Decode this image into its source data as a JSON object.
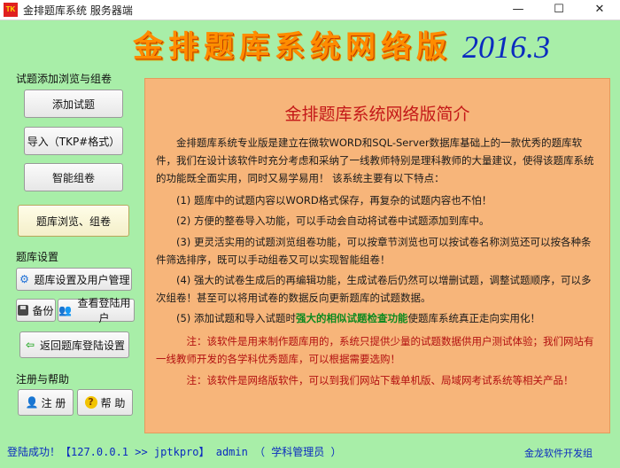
{
  "window": {
    "app_icon_text": "TK",
    "title": "金排题库系统 服务器端",
    "minimize": "—",
    "maximize": "☐",
    "close": "✕"
  },
  "banner": {
    "title": "金排题库系统网络版",
    "version": "2016.3"
  },
  "sidebar": {
    "section_browse": "试题添加浏览与组卷",
    "btn_add": "添加试题",
    "btn_import": "导入（TKP#格式）",
    "btn_smart": "智能组卷",
    "btn_browse": "题库浏览、组卷",
    "section_settings": "题库设置",
    "btn_settings": "题库设置及用户管理",
    "btn_backup": "备份",
    "btn_view_users": "查看登陆用户",
    "btn_return": "返回题库登陆设置",
    "section_register": "注册与帮助",
    "btn_register": "注 册",
    "btn_help": "帮 助"
  },
  "intro": {
    "title": "金排题库系统网络版简介",
    "p0": "金排题库系统专业版是建立在微软WORD和SQL-Server数据库基础上的一款优秀的题库软件，我们在设计该软件时充分考虑和采纳了一线教师特别是理科教师的大量建议，使得该题库系统的功能既全面实用，同时又易学易用！ 该系统主要有以下特点：",
    "p1": "(1) 题库中的试题内容以WORD格式保存，再复杂的试题内容也不怕！",
    "p2": "(2) 方便的整卷导入功能，可以手动会自动将试卷中试题添加到库中。",
    "p3": "(3) 更灵活实用的试题浏览组卷功能，可以按章节浏览也可以按试卷名称浏览还可以按各种条件筛选排序，既可以手动组卷又可以实现智能组卷！",
    "p4": "(4) 强大的试卷生成后的再编辑功能，生成试卷后仍然可以增删试题，调整试题顺序，可以多次组卷！甚至可以将用试卷的数据反向更新题库的试题数据。",
    "p5_a": "(5) 添加试题和导入试题时",
    "p5_hl": "强大的相似试题检查功能",
    "p5_b": "使题库系统真正走向实用化！",
    "note1": "注：该软件是用来制作题库用的，系统只提供少量的试题数据供用户测试体验；我们网站有一线教师开发的各学科优秀题库，可以根据需要选购！",
    "note2": "注：该软件是网络版软件，可以到我们网站下载单机版、局域网考试系统等相关产品！"
  },
  "status": {
    "login": "登陆成功！【127.0.0.1 >> jptkpro】 admin （ 学科管理员 ）",
    "developer": "金龙软件开发组"
  }
}
